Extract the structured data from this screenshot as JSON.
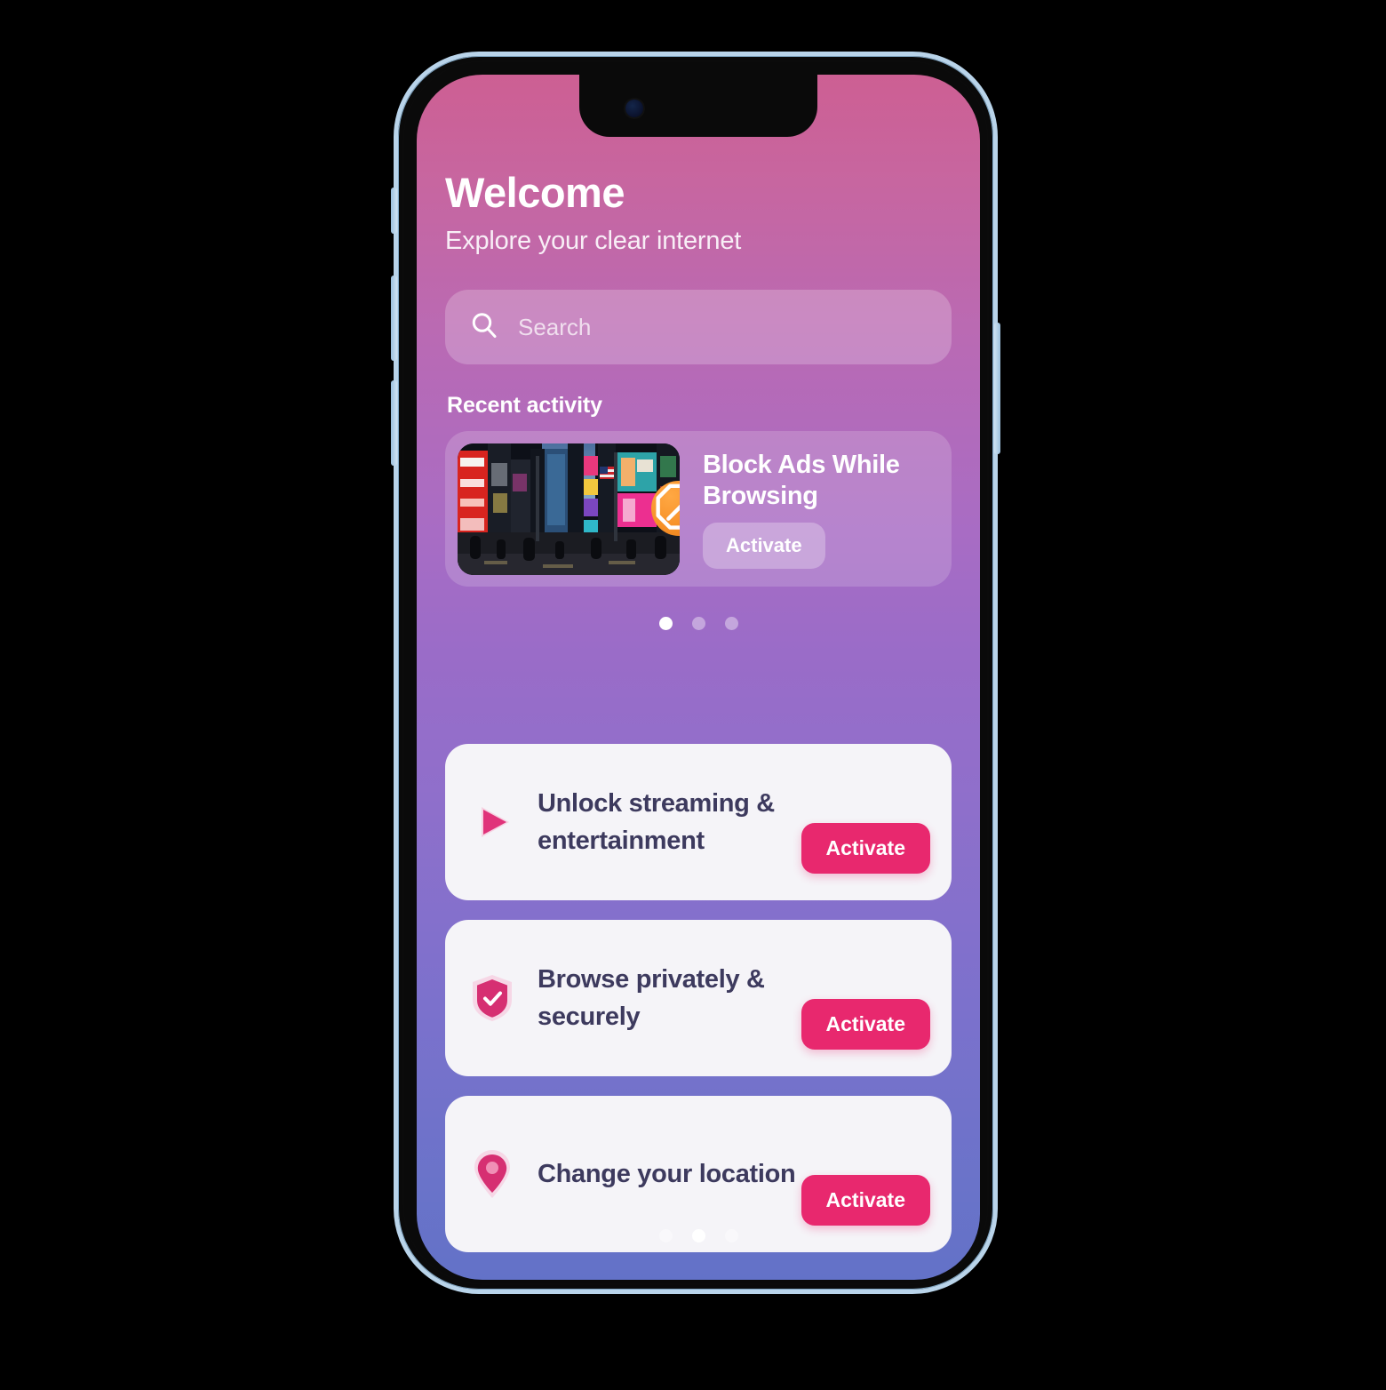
{
  "device": {
    "frame_color": "#b9d4ea",
    "buttons": [
      "silent-switch",
      "volume-up",
      "volume-down",
      "power"
    ]
  },
  "theme": {
    "gradient_top": "#cd5f93",
    "gradient_mid": "#9a6cc8",
    "gradient_bottom": "#6372c8",
    "accent_pink": "#e8286e",
    "badge_orange": "#f79229",
    "card_bg": "#f5f4f8",
    "card_text": "#3d3a5e"
  },
  "header": {
    "title": "Welcome",
    "subtitle": "Explore your clear internet"
  },
  "search": {
    "placeholder": "Search",
    "value": "",
    "icon": "search-icon"
  },
  "recent": {
    "section_title": "Recent activity",
    "card": {
      "title": "Block Ads While Browsing",
      "activate_label": "Activate",
      "thumbnail_alt": "times-square-night-billboards",
      "badge_icon": "block-icon"
    },
    "pagination": {
      "count": 3,
      "active_index": 0
    }
  },
  "features": {
    "items": [
      {
        "title": "Unlock streaming & entertainment",
        "icon": "play-icon",
        "activate_label": "Activate"
      },
      {
        "title": "Browse privately & securely",
        "icon": "shield-check-icon",
        "activate_label": "Activate"
      },
      {
        "title": "Change your location",
        "icon": "location-pin-icon",
        "activate_label": "Activate"
      }
    ],
    "pagination": {
      "count": 3,
      "active_index": 1
    }
  }
}
